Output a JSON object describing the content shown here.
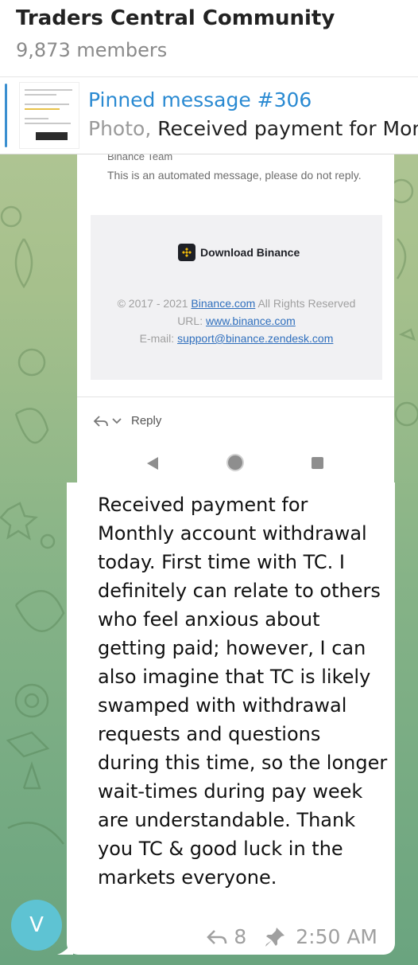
{
  "chat": {
    "title": "Traders Central Community",
    "members": "9,873 members"
  },
  "pinned": {
    "title": "Pinned message #306",
    "type": "Photo,",
    "preview": " Received payment for Monthly account withdrawal today"
  },
  "screenshot": {
    "team_line": "Binance Team",
    "auto_message": "This is an automated message, please do not reply.",
    "download_label": "Download Binance",
    "copyright_prefix": "© 2017 - 2021 ",
    "copyright_link": "Binance.com",
    "copyright_suffix": " All Rights Reserved",
    "url_label": "URL: ",
    "url_link": "www.binance.com",
    "email_label": "E-mail: ",
    "email_link": "support@binance.zendesk.com",
    "reply_label": "Reply"
  },
  "message": {
    "text": "Received payment for Monthly account withdrawal today. First time with TC. I definitely can relate to others who feel anxious about getting paid; however, I can also imagine that TC is likely swamped with withdrawal requests and questions during this time, so the longer wait-times during pay week are understandable. Thank you TC & good luck in the markets everyone.",
    "reply_count": "8",
    "time": "2:50 AM",
    "avatar_letter": "V"
  },
  "colors": {
    "accent": "#2a8ad2",
    "avatar": "#5ec3d3",
    "binance_yellow": "#f0b90b"
  },
  "icons": [
    "reply-arrow-icon",
    "pin-icon",
    "binance-logo-icon",
    "chevron-down-icon",
    "nav-back-icon",
    "nav-home-icon",
    "nav-recent-icon"
  ]
}
